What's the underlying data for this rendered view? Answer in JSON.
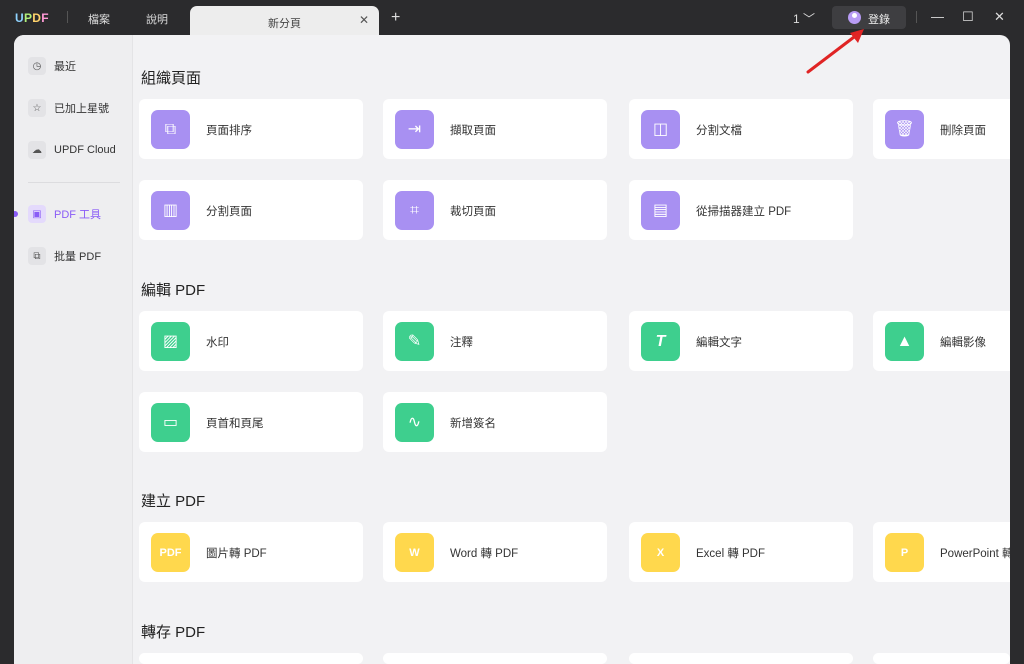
{
  "titlebar": {
    "logo": "UPDF",
    "menu": [
      "檔案",
      "說明"
    ],
    "tab_title": "新分頁",
    "tab_close": "✕",
    "new_tab": "+",
    "page_count": "1 ﹀",
    "login_label": "登錄",
    "minimize": "—",
    "maximize": "☐",
    "close": "✕"
  },
  "sidebar": {
    "items": [
      {
        "label": "最近",
        "icon": "clock-icon"
      },
      {
        "label": "已加上星號",
        "icon": "star-icon"
      },
      {
        "label": "UPDF Cloud",
        "icon": "cloud-icon"
      },
      {
        "label": "PDF 工具",
        "icon": "toolbox-icon"
      },
      {
        "label": "批量 PDF",
        "icon": "batch-icon"
      }
    ]
  },
  "sections": [
    {
      "title": "組織頁面",
      "cards": [
        {
          "label": "頁面排序",
          "icon": "reorder-pages-icon"
        },
        {
          "label": "擷取頁面",
          "icon": "extract-pages-icon"
        },
        {
          "label": "分割文檔",
          "icon": "split-document-icon"
        },
        {
          "label": "刪除頁面",
          "icon": "trash-icon"
        },
        {
          "label": "分割頁面",
          "icon": "split-pages-icon"
        },
        {
          "label": "裁切頁面",
          "icon": "crop-pages-icon"
        },
        {
          "label": "從掃描器建立 PDF",
          "icon": "scanner-icon"
        }
      ]
    },
    {
      "title": "編輯 PDF",
      "cards": [
        {
          "label": "水印",
          "icon": "watermark-icon"
        },
        {
          "label": "注釋",
          "icon": "annotate-icon"
        },
        {
          "label": "編輯文字",
          "icon": "edit-text-icon"
        },
        {
          "label": "編輯影像",
          "icon": "edit-image-icon"
        },
        {
          "label": "頁首和頁尾",
          "icon": "header-footer-icon"
        },
        {
          "label": "新增簽名",
          "icon": "signature-icon"
        }
      ]
    },
    {
      "title": "建立 PDF",
      "cards": [
        {
          "label": "圖片轉 PDF",
          "icon": "image-to-pdf-icon"
        },
        {
          "label": "Word 轉 PDF",
          "icon": "word-to-pdf-icon"
        },
        {
          "label": "Excel 轉 PDF",
          "icon": "excel-to-pdf-icon"
        },
        {
          "label": "PowerPoint 轉",
          "icon": "powerpoint-to-pdf-icon"
        }
      ]
    },
    {
      "title": "轉存 PDF"
    }
  ],
  "colors": {
    "accent": "#8a5cf6",
    "organize": "#a890f2",
    "edit": "#3ecf8e",
    "create": "#ffd84d",
    "arrow": "#e02424"
  }
}
